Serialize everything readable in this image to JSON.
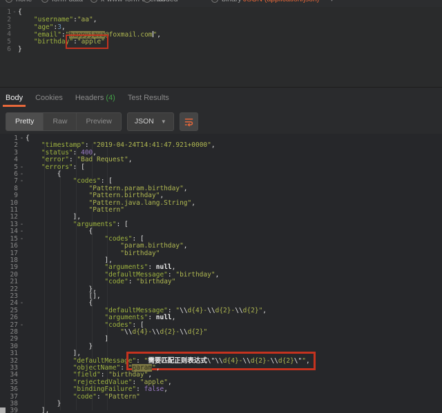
{
  "body_type_bar": {
    "options": [
      "none",
      "form-data",
      "x-www-form-urlencoded",
      "raw",
      "binary"
    ],
    "content_type": "JSON (application/json)",
    "chevron": "▾"
  },
  "request_editor": {
    "lines": [
      {
        "n": "1",
        "f": true,
        "t": [
          [
            "p",
            "{"
          ]
        ]
      },
      {
        "n": "2",
        "t": [
          [
            "w",
            "    "
          ],
          [
            "k",
            "\"username\""
          ],
          [
            "p",
            ":"
          ],
          [
            "s",
            "\"aa\""
          ],
          [
            "p",
            ","
          ]
        ]
      },
      {
        "n": "3",
        "t": [
          [
            "w",
            "    "
          ],
          [
            "k",
            "\"age\""
          ],
          [
            "p",
            ":"
          ],
          [
            "numb",
            "3"
          ],
          [
            "p",
            ","
          ]
        ]
      },
      {
        "n": "4",
        "t": [
          [
            "w",
            "    "
          ],
          [
            "k",
            "\"email\""
          ],
          [
            "p",
            ":"
          ],
          [
            "s",
            "\""
          ],
          [
            "hl",
            "happyjava"
          ],
          [
            "s",
            "@foxmail.com"
          ],
          [
            "cur",
            ""
          ],
          [
            "s",
            "\""
          ],
          [
            "p",
            ","
          ]
        ]
      },
      {
        "n": "5",
        "t": [
          [
            "w",
            "    "
          ],
          [
            "k",
            "\"birthday"
          ],
          [
            "box",
            [
              [
                "k",
                "\""
              ],
              [
                "p",
                ":"
              ],
              [
                "s",
                "\"apple\""
              ]
            ]
          ]
        ]
      },
      {
        "n": "6",
        "t": [
          [
            "p",
            "}"
          ]
        ]
      }
    ]
  },
  "response_section": {
    "tabs": [
      {
        "label": "Body",
        "active": true
      },
      {
        "label": "Cookies",
        "active": false
      },
      {
        "label": "Headers",
        "count": "(4)",
        "active": false
      },
      {
        "label": "Test Results",
        "active": false
      }
    ],
    "toolbar": {
      "views": [
        "Pretty",
        "Raw",
        "Preview"
      ],
      "active_view": "Pretty",
      "format": "JSON",
      "chevron": "▼"
    }
  },
  "response_editor": {
    "lines": [
      {
        "n": "1",
        "f": true,
        "t": [
          [
            "p",
            "{"
          ]
        ]
      },
      {
        "n": "2",
        "t": [
          [
            "w",
            "    "
          ],
          [
            "k",
            "\"timestamp\""
          ],
          [
            "p",
            ": "
          ],
          [
            "s",
            "\"2019-04-24T14:41:47.921+0000\""
          ],
          [
            "p",
            ","
          ]
        ]
      },
      {
        "n": "3",
        "t": [
          [
            "w",
            "    "
          ],
          [
            "k",
            "\"status\""
          ],
          [
            "p",
            ": "
          ],
          [
            "pur",
            "400"
          ],
          [
            "p",
            ","
          ]
        ]
      },
      {
        "n": "4",
        "t": [
          [
            "w",
            "    "
          ],
          [
            "k",
            "\"error\""
          ],
          [
            "p",
            ": "
          ],
          [
            "s",
            "\"Bad Request\""
          ],
          [
            "p",
            ","
          ]
        ]
      },
      {
        "n": "5",
        "f": true,
        "t": [
          [
            "w",
            "    "
          ],
          [
            "k",
            "\"errors\""
          ],
          [
            "p",
            ": ["
          ]
        ]
      },
      {
        "n": "6",
        "f": true,
        "t": [
          [
            "w",
            "        "
          ],
          [
            "p",
            "{"
          ]
        ]
      },
      {
        "n": "7",
        "f": true,
        "t": [
          [
            "w",
            "            "
          ],
          [
            "k",
            "\"codes\""
          ],
          [
            "p",
            ": ["
          ]
        ]
      },
      {
        "n": "8",
        "t": [
          [
            "w",
            "                "
          ],
          [
            "s",
            "\"Pattern.param.birthday\""
          ],
          [
            "p",
            ","
          ]
        ]
      },
      {
        "n": "9",
        "t": [
          [
            "w",
            "                "
          ],
          [
            "s",
            "\"Pattern.birthday\""
          ],
          [
            "p",
            ","
          ]
        ]
      },
      {
        "n": "10",
        "t": [
          [
            "w",
            "                "
          ],
          [
            "s",
            "\"Pattern.java.lang.String\""
          ],
          [
            "p",
            ","
          ]
        ]
      },
      {
        "n": "11",
        "t": [
          [
            "w",
            "                "
          ],
          [
            "s",
            "\"Pattern\""
          ]
        ]
      },
      {
        "n": "12",
        "t": [
          [
            "w",
            "            "
          ],
          [
            "p",
            "],"
          ]
        ]
      },
      {
        "n": "13",
        "f": true,
        "t": [
          [
            "w",
            "            "
          ],
          [
            "k",
            "\"arguments\""
          ],
          [
            "p",
            ": ["
          ]
        ]
      },
      {
        "n": "14",
        "f": true,
        "t": [
          [
            "w",
            "                "
          ],
          [
            "p",
            "{"
          ]
        ]
      },
      {
        "n": "15",
        "f": true,
        "t": [
          [
            "w",
            "                    "
          ],
          [
            "k",
            "\"codes\""
          ],
          [
            "p",
            ": ["
          ]
        ]
      },
      {
        "n": "16",
        "t": [
          [
            "w",
            "                        "
          ],
          [
            "s",
            "\"param.birthday\""
          ],
          [
            "p",
            ","
          ]
        ]
      },
      {
        "n": "17",
        "t": [
          [
            "w",
            "                        "
          ],
          [
            "s",
            "\"birthday\""
          ]
        ]
      },
      {
        "n": "18",
        "t": [
          [
            "w",
            "                    "
          ],
          [
            "p",
            "],"
          ]
        ]
      },
      {
        "n": "19",
        "t": [
          [
            "w",
            "                    "
          ],
          [
            "k",
            "\"arguments\""
          ],
          [
            "p",
            ": "
          ],
          [
            "nul",
            "null"
          ],
          [
            "p",
            ","
          ]
        ]
      },
      {
        "n": "20",
        "t": [
          [
            "w",
            "                    "
          ],
          [
            "k",
            "\"defaultMessage\""
          ],
          [
            "p",
            ": "
          ],
          [
            "s",
            "\"birthday\""
          ],
          [
            "p",
            ","
          ]
        ]
      },
      {
        "n": "21",
        "t": [
          [
            "w",
            "                    "
          ],
          [
            "k",
            "\"code\""
          ],
          [
            "p",
            ": "
          ],
          [
            "s",
            "\"birthday\""
          ]
        ]
      },
      {
        "n": "22",
        "t": [
          [
            "w",
            "                "
          ],
          [
            "p",
            "},"
          ]
        ]
      },
      {
        "n": "23",
        "t": [
          [
            "w",
            "                "
          ],
          [
            "p",
            "[],"
          ]
        ]
      },
      {
        "n": "24",
        "f": true,
        "t": [
          [
            "w",
            "                "
          ],
          [
            "p",
            "{"
          ]
        ]
      },
      {
        "n": "25",
        "t": [
          [
            "w",
            "                    "
          ],
          [
            "k",
            "\"defaultMessage\""
          ],
          [
            "p",
            ": "
          ],
          [
            "s",
            "\""
          ],
          [
            "esc",
            "\\\\"
          ],
          [
            "s",
            "d{4}-"
          ],
          [
            "esc",
            "\\\\"
          ],
          [
            "s",
            "d{2}-"
          ],
          [
            "esc",
            "\\\\"
          ],
          [
            "s",
            "d{2}"
          ],
          [
            "s",
            "\""
          ],
          [
            "p",
            ","
          ]
        ]
      },
      {
        "n": "26",
        "t": [
          [
            "w",
            "                    "
          ],
          [
            "k",
            "\"arguments\""
          ],
          [
            "p",
            ": "
          ],
          [
            "nul",
            "null"
          ],
          [
            "p",
            ","
          ]
        ]
      },
      {
        "n": "27",
        "f": true,
        "t": [
          [
            "w",
            "                    "
          ],
          [
            "k",
            "\"codes\""
          ],
          [
            "p",
            ": ["
          ]
        ]
      },
      {
        "n": "28",
        "t": [
          [
            "w",
            "                        "
          ],
          [
            "s",
            "\""
          ],
          [
            "esc",
            "\\\\"
          ],
          [
            "s",
            "d{4}-"
          ],
          [
            "esc",
            "\\\\"
          ],
          [
            "s",
            "d{2}-"
          ],
          [
            "esc",
            "\\\\"
          ],
          [
            "s",
            "d{2}"
          ],
          [
            "s",
            "\""
          ]
        ]
      },
      {
        "n": "29",
        "t": [
          [
            "w",
            "                    "
          ],
          [
            "p",
            "]"
          ]
        ]
      },
      {
        "n": "30",
        "t": [
          [
            "w",
            "                "
          ],
          [
            "p",
            "}"
          ]
        ]
      },
      {
        "n": "31",
        "t": [
          [
            "w",
            "            "
          ],
          [
            "p",
            "],"
          ]
        ]
      },
      {
        "n": "32",
        "t": [
          [
            "w",
            "            "
          ],
          [
            "k",
            "\"defaultMessage"
          ],
          [
            "box",
            [
              [
                "k",
                "\""
              ],
              [
                "p",
                ": "
              ],
              [
                "s",
                "\""
              ],
              [
                "cn",
                "需要匹配正则表达式"
              ],
              [
                "esc",
                "\\\""
              ],
              [
                "esc",
                "\\\\"
              ],
              [
                "s",
                "d{4}-"
              ],
              [
                "esc",
                "\\\\"
              ],
              [
                "s",
                "d{2}-"
              ],
              [
                "esc",
                "\\\\"
              ],
              [
                "s",
                "d{2}"
              ],
              [
                "esc",
                "\\\""
              ],
              [
                "s",
                "\""
              ],
              [
                "p",
                ","
              ]
            ]
          ]
        ]
      },
      {
        "n": "33",
        "t": [
          [
            "w",
            "            "
          ],
          [
            "k",
            "\"objectName\""
          ],
          [
            "p",
            ": "
          ],
          [
            "s",
            "\""
          ],
          [
            "hl",
            "param"
          ],
          [
            "s",
            "\""
          ],
          [
            "p",
            ","
          ]
        ]
      },
      {
        "n": "34",
        "t": [
          [
            "w",
            "            "
          ],
          [
            "k",
            "\"field\""
          ],
          [
            "p",
            ": "
          ],
          [
            "s",
            "\"birthday\""
          ],
          [
            "p",
            ","
          ]
        ]
      },
      {
        "n": "35",
        "t": [
          [
            "w",
            "            "
          ],
          [
            "k",
            "\"rejectedValue\""
          ],
          [
            "p",
            ": "
          ],
          [
            "s",
            "\"apple\""
          ],
          [
            "p",
            ","
          ]
        ]
      },
      {
        "n": "36",
        "t": [
          [
            "w",
            "            "
          ],
          [
            "k",
            "\"bindingFailure\""
          ],
          [
            "p",
            ": "
          ],
          [
            "pur",
            "false"
          ],
          [
            "p",
            ","
          ]
        ]
      },
      {
        "n": "37",
        "t": [
          [
            "w",
            "            "
          ],
          [
            "k",
            "\"code\""
          ],
          [
            "p",
            ": "
          ],
          [
            "s",
            "\"Pattern\""
          ]
        ]
      },
      {
        "n": "38",
        "t": [
          [
            "w",
            "        "
          ],
          [
            "p",
            "}"
          ]
        ]
      },
      {
        "n": "39",
        "t": [
          [
            "w",
            "    "
          ],
          [
            "p",
            "],"
          ]
        ]
      }
    ]
  },
  "colors": {
    "accent_orange": "#e8683a",
    "headers_count_green": "#43a047",
    "annotation_red": "#c5331f",
    "selection_olive": "#7d7843"
  }
}
